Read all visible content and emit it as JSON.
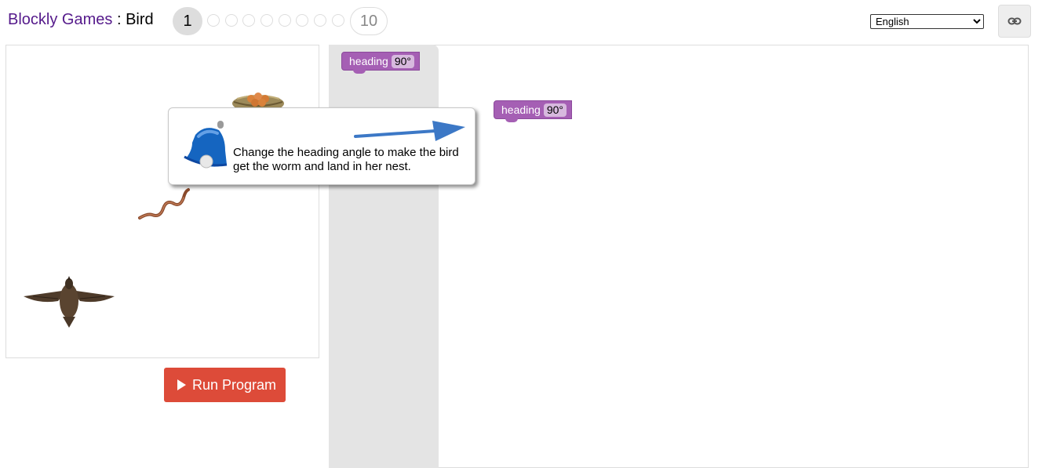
{
  "header": {
    "app_name": "Blockly Games",
    "separator": ":",
    "level_name": "Bird",
    "levels": {
      "current": "1",
      "last": "10"
    }
  },
  "language": {
    "selected": "English"
  },
  "link_button": {
    "icon": "link-icon"
  },
  "visualization": {
    "sprites": [
      "nest-image",
      "worm-image",
      "bird-image"
    ]
  },
  "run_button": {
    "label": "Run Program",
    "icon": "play-icon"
  },
  "toolbox": {
    "blocks": [
      {
        "label": "heading",
        "value": "90°"
      }
    ]
  },
  "workspace": {
    "blocks": [
      {
        "label": "heading",
        "value": "90°"
      }
    ]
  },
  "hint": {
    "text": "Change the heading angle to make the bird get the worm and land in her nest.",
    "icon": "bell-icon",
    "arrow": "arrow-icon"
  },
  "colors": {
    "app_title": "#551a8b",
    "block": "#a55fb4",
    "run_button": "#dd4b39",
    "flyout": "#e4e4e4"
  }
}
